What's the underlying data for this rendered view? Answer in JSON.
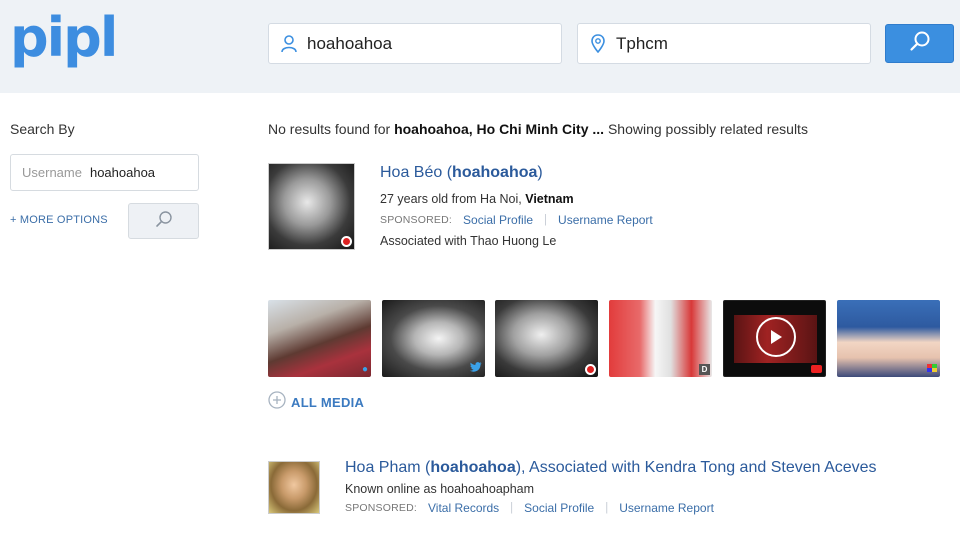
{
  "header": {
    "logo": "pipl",
    "name_query": "hoahoahoa",
    "location_query": "Tphcm"
  },
  "sidebar": {
    "title": "Search By",
    "field_label": "Username",
    "field_value": "hoahoahoa",
    "more_options": "+ MORE OPTIONS"
  },
  "results_banner": {
    "prefix": "No results found for ",
    "query": "hoahoahoa, Ho Chi Minh City ...",
    "suffix": " Showing possibly related results"
  },
  "result1": {
    "name": "Hoa Béo (",
    "username": "hoahoahoa",
    "name_close": ")",
    "age_location": "27 years old from Ha Noi, ",
    "country": "Vietnam",
    "sponsored": "SPONSORED:",
    "links": [
      "Social Profile",
      "Username Report"
    ],
    "associated": "Associated with Thao Huong Le"
  },
  "media": {
    "all_media": "ALL MEDIA",
    "d_badge": "D"
  },
  "result2": {
    "name": "Hoa Pham (",
    "username": "hoahoahoa",
    "name_rest": "), Associated with Kendra Tong and Steven Aceves",
    "known": "Known online as hoahoahoapham",
    "sponsored": "SPONSORED:",
    "links": [
      "Vital Records",
      "Social Profile",
      "Username Report"
    ]
  },
  "colors": {
    "accent": "#3b8fe0",
    "link": "#2b5a9b",
    "header_bg": "#eef2f6"
  }
}
